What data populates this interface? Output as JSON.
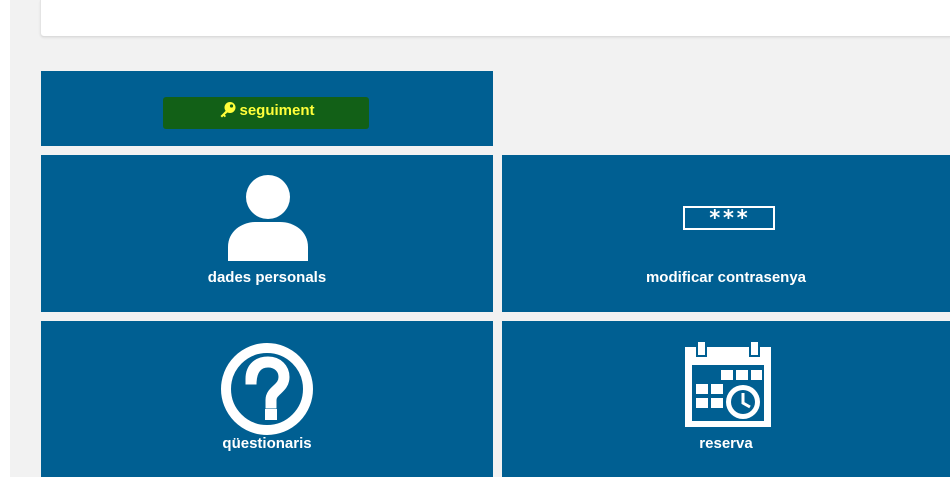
{
  "tiles": {
    "seguiment": {
      "label": "seguiment",
      "icon": "key-icon",
      "highlight_color": "#126017",
      "text_color": "#ffff3a"
    },
    "dades_personals": {
      "label": "dades personals",
      "icon": "user-icon"
    },
    "modificar_contrasenya": {
      "label": "modificar contrasenya",
      "icon": "password-icon",
      "icon_text": "***"
    },
    "questionaris": {
      "label": "qüestionaris",
      "icon": "question-circle-icon"
    },
    "reserva": {
      "label": "reserva",
      "icon": "calendar-clock-icon"
    }
  },
  "colors": {
    "tile_bg": "#005f92",
    "page_bg": "#f2f2f2"
  }
}
